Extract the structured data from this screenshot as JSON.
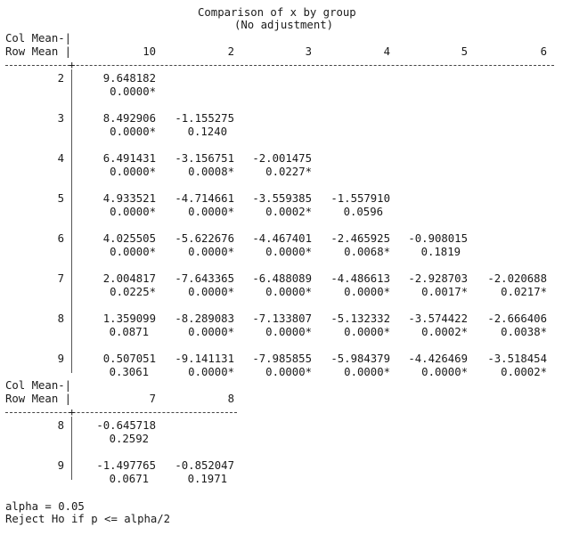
{
  "title": "Comparison of x by group",
  "subtitle": "(No adjustment)",
  "header_line1": "Col Mean-|",
  "header_line2": "Row Mean |",
  "block1": {
    "cols": [
      "10",
      "2",
      "3",
      "4",
      "5",
      "6"
    ],
    "rows": [
      {
        "label": "2",
        "diffs": [
          "9.648182"
        ],
        "pvals": [
          "0.0000*"
        ]
      },
      {
        "label": "3",
        "diffs": [
          "8.492906",
          "-1.155275"
        ],
        "pvals": [
          "0.0000*",
          "0.1240"
        ]
      },
      {
        "label": "4",
        "diffs": [
          "6.491431",
          "-3.156751",
          "-2.001475"
        ],
        "pvals": [
          "0.0000*",
          "0.0008*",
          "0.0227*"
        ]
      },
      {
        "label": "5",
        "diffs": [
          "4.933521",
          "-4.714661",
          "-3.559385",
          "-1.557910"
        ],
        "pvals": [
          "0.0000*",
          "0.0000*",
          "0.0002*",
          "0.0596"
        ]
      },
      {
        "label": "6",
        "diffs": [
          "4.025505",
          "-5.622676",
          "-4.467401",
          "-2.465925",
          "-0.908015"
        ],
        "pvals": [
          "0.0000*",
          "0.0000*",
          "0.0000*",
          "0.0068*",
          "0.1819"
        ]
      },
      {
        "label": "7",
        "diffs": [
          "2.004817",
          "-7.643365",
          "-6.488089",
          "-4.486613",
          "-2.928703",
          "-2.020688"
        ],
        "pvals": [
          "0.0225*",
          "0.0000*",
          "0.0000*",
          "0.0000*",
          "0.0017*",
          "0.0217*"
        ]
      },
      {
        "label": "8",
        "diffs": [
          "1.359099",
          "-8.289083",
          "-7.133807",
          "-5.132332",
          "-3.574422",
          "-2.666406"
        ],
        "pvals": [
          "0.0871",
          "0.0000*",
          "0.0000*",
          "0.0000*",
          "0.0002*",
          "0.0038*"
        ]
      },
      {
        "label": "9",
        "diffs": [
          "0.507051",
          "-9.141131",
          "-7.985855",
          "-5.984379",
          "-4.426469",
          "-3.518454"
        ],
        "pvals": [
          "0.3061",
          "0.0000*",
          "0.0000*",
          "0.0000*",
          "0.0000*",
          "0.0002*"
        ]
      }
    ]
  },
  "block2": {
    "cols": [
      "7",
      "8"
    ],
    "rows": [
      {
        "label": "8",
        "diffs": [
          "-0.645718"
        ],
        "pvals": [
          "0.2592"
        ]
      },
      {
        "label": "9",
        "diffs": [
          "-1.497765",
          "-0.852047"
        ],
        "pvals": [
          "0.0671",
          "0.1971"
        ]
      }
    ]
  },
  "footer_alpha": "alpha = 0.05",
  "footer_rule": "Reject Ho if p <= alpha/2"
}
